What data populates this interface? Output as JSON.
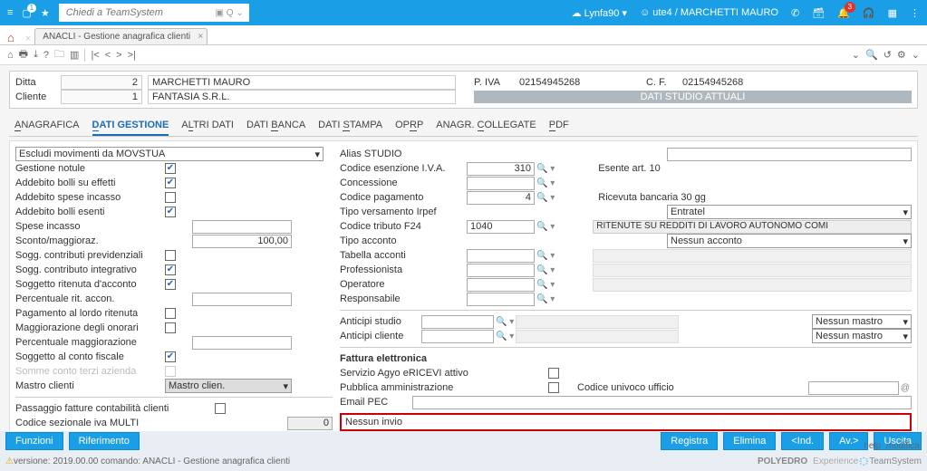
{
  "top": {
    "search_placeholder": "Chiedi a TeamSystem",
    "user1": "Lynfa90",
    "user2": "ute4 / MARCHETTI MAURO",
    "notif_count": "3"
  },
  "tab": {
    "title": "ANACLI - Gestione anagrafica clienti"
  },
  "header": {
    "ditta_lbl": "Ditta",
    "ditta_val": "2",
    "ditta_name": "MARCHETTI MAURO",
    "cliente_lbl": "Cliente",
    "cliente_val": "1",
    "cliente_name": "FANTASIA S.R.L.",
    "piva_lbl": "P. IVA",
    "piva_val": "02154945268",
    "cf_lbl": "C. F.",
    "cf_val": "02154945268",
    "btn_dati": "DATI STUDIO ATTUALI"
  },
  "tabs": [
    "ANAGRAFICA",
    "DATI GESTIONE",
    "ALTRI DATI",
    "DATI BANCA",
    "DATI STAMPA",
    "OPRP",
    "ANAGR. COLLEGATE",
    "PDF"
  ],
  "left": {
    "select_top": "Escludi movimenti da MOVSTUA",
    "rows": [
      {
        "label": "Gestione notule",
        "check": true
      },
      {
        "label": "Addebito bolli su effetti",
        "check": true
      },
      {
        "label": "Addebito spese incasso",
        "check": false
      },
      {
        "label": "Addebito bolli esenti",
        "check": true
      }
    ],
    "spese_lbl": "Spese incasso",
    "spese_val": "",
    "sconto_lbl": "Sconto/maggioraz.",
    "sconto_val": "100,00",
    "rows2": [
      {
        "label": "Sogg. contributi previdenziali",
        "check": false
      },
      {
        "label": "Sogg. contributo integrativo",
        "check": true
      },
      {
        "label": "Soggetto ritenuta d'acconto",
        "check": true
      }
    ],
    "perc_rit_lbl": "Percentuale rit. accon.",
    "perc_rit_val": "",
    "rows3": [
      {
        "label": "Pagamento al lordo ritenuta",
        "check": false
      },
      {
        "label": "Maggiorazione degli onorari",
        "check": false
      }
    ],
    "perc_mag_lbl": "Percentuale maggiorazione",
    "perc_mag_val": "",
    "rows4": [
      {
        "label": "Soggetto al conto fiscale",
        "check": true
      },
      {
        "label": "Somme conto terzi azienda",
        "check": false,
        "grey": true
      }
    ],
    "mastro_lbl": "Mastro clienti",
    "mastro_val": "Mastro clien.",
    "passaggio_lbl": "Passaggio fatture contabilità clienti",
    "codsez_lbl": "Codice sezionale iva MULTI",
    "codsez_val": "0"
  },
  "right": {
    "alias_lbl": "Alias STUDIO",
    "cod_esenz_lbl": "Codice esenzione I.V.A.",
    "cod_esenz_val": "310",
    "cod_esenz_txt": "Esente art. 10",
    "concess_lbl": "Concessione",
    "cod_pag_lbl": "Codice pagamento",
    "cod_pag_val": "4",
    "cod_pag_txt": "Ricevuta bancaria 30 gg",
    "tipo_vers_lbl": "Tipo versamento Irpef",
    "tipo_vers_val": "Entratel",
    "cod_trib_lbl": "Codice tributo F24",
    "cod_trib_val": "1040",
    "cod_trib_txt": "RITENUTE SU REDDITI DI LAVORO AUTONOMO COMI",
    "tipo_acc_lbl": "Tipo acconto",
    "tipo_acc_val": "Nessun acconto",
    "tab_acc_lbl": "Tabella acconti",
    "prof_lbl": "Professionista",
    "oper_lbl": "Operatore",
    "resp_lbl": "Responsabile",
    "ant_studio_lbl": "Anticipi studio",
    "ant_studio_val": "Nessun mastro",
    "ant_cliente_lbl": "Anticipi cliente",
    "ant_cliente_val": "Nessun mastro",
    "fatt_title": "Fattura elettronica",
    "serv_lbl": "Servizio Agyo eRICEVI attivo",
    "pubamm_lbl": "Pubblica amministrazione",
    "codun_lbl": "Codice univoco ufficio",
    "email_lbl": "Email PEC",
    "nessun_invio": "Nessun invio"
  },
  "footer": {
    "funzioni": "Funzioni",
    "riferimento": "Riferimento",
    "registra": "Registra",
    "elimina": "Elimina",
    "ind": "<Ind.",
    "av": "Av.>",
    "uscita": "Uscita",
    "help": "help",
    "modifica": "modifica",
    "version": "versione: 2019.00.00 comando: ANACLI - Gestione anagrafica clienti",
    "brand": "POLYEDRO",
    "brand2": "Experience",
    "brand3": "TeamSystem"
  }
}
